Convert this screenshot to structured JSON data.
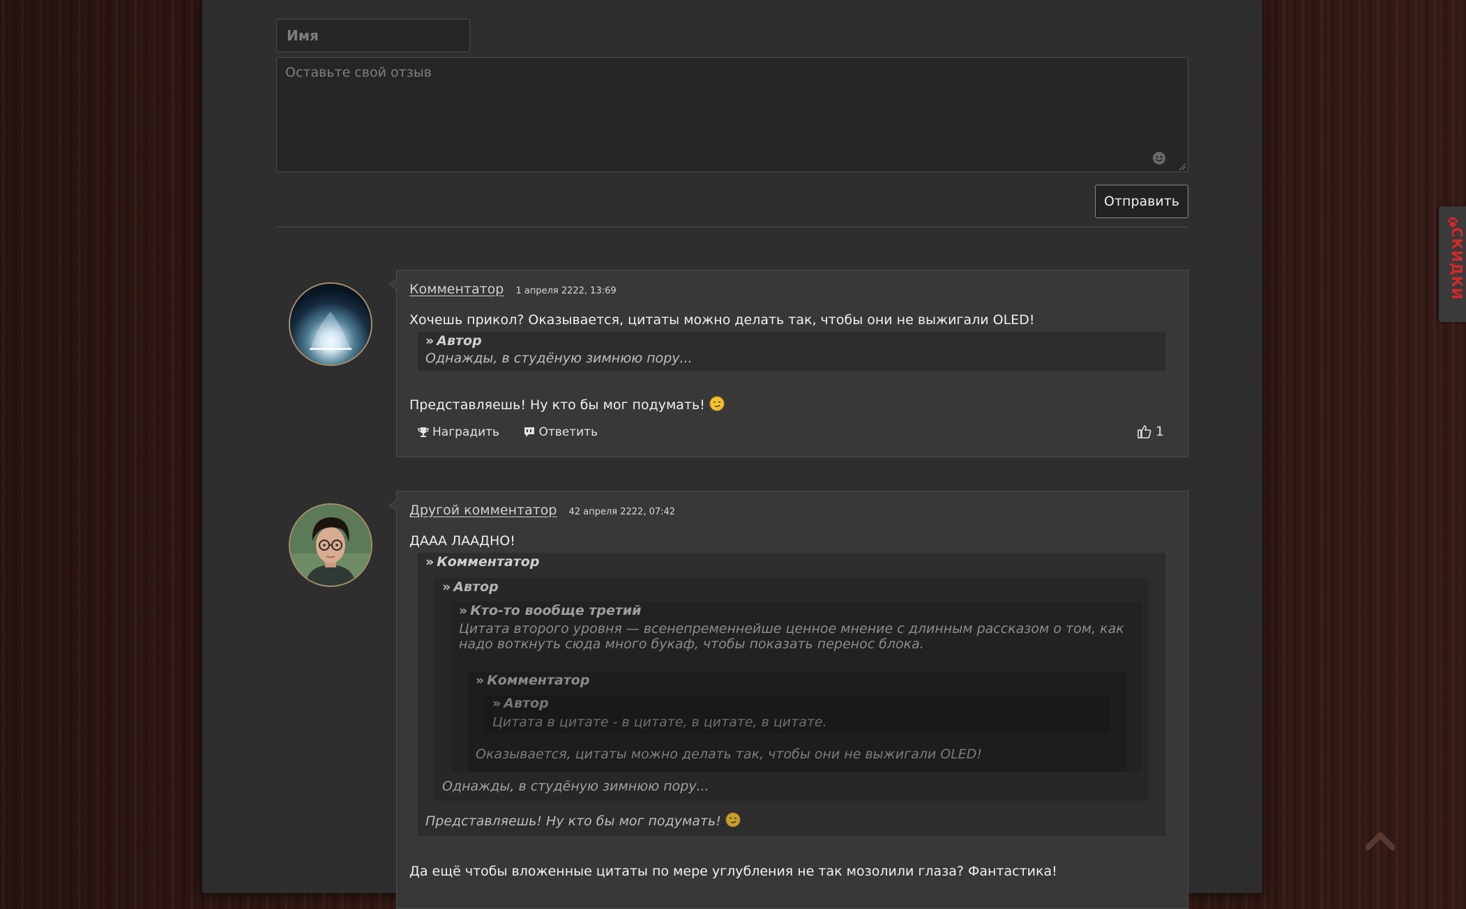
{
  "form": {
    "name_placeholder": "Имя",
    "review_placeholder": "Оставьте свой отзыв",
    "submit_label": "Отправить"
  },
  "comments": [
    {
      "author": "Комментатор",
      "date": "1 апреля 2222, 13:69",
      "text_before": "Хочешь прикол? Оказывается, цитаты можно делать так, чтобы они не выжигали OLED!",
      "quote": {
        "author": "Автор",
        "text": "Однажды, в студёную зимнюю пору..."
      },
      "text_after": "Представляешь! Ну кто бы мог подумать!",
      "award_label": "Наградить",
      "reply_label": "Ответить",
      "likes": "1"
    },
    {
      "author": "Другой комментатор",
      "date": "42 апреля 2222, 07:42",
      "text_before": "ДААА ЛААДНО!",
      "quote": {
        "author": "Комментатор",
        "text_after": "Представляешь! Ну кто бы мог подумать!",
        "quote": {
          "author": "Автор",
          "text_after": "Однажды, в студёную зимнюю пору...",
          "quote": {
            "author": "Кто-то вообще третий",
            "text_line1": "Цитата второго уровня — всенепременнейше ценное мнение с длинным рассказом о том, как",
            "text_line2": "надо воткнуть сюда много букаф, чтобы показать перенос блока.",
            "quote": {
              "author": "Комментатор",
              "text_after": "Оказывается, цитаты можно делать так, чтобы они не выжигали OLED!",
              "quote": {
                "author": "Автор",
                "text": "Цитата в цитате - в цитате, в цитате, в цитате."
              }
            }
          }
        }
      },
      "text_after": "Да ещё чтобы вложенные цитаты по мере углубления не так мозолили глаза? Фантастика!"
    }
  ],
  "side_tab": {
    "label": "СКИДКИ",
    "color": "#d6262a"
  },
  "icons": [
    "smiley-icon",
    "trophy-icon",
    "reply-icon",
    "thumbs-up-icon",
    "paw-icon",
    "scroll-top-icon",
    "quote-arrow-icon"
  ]
}
